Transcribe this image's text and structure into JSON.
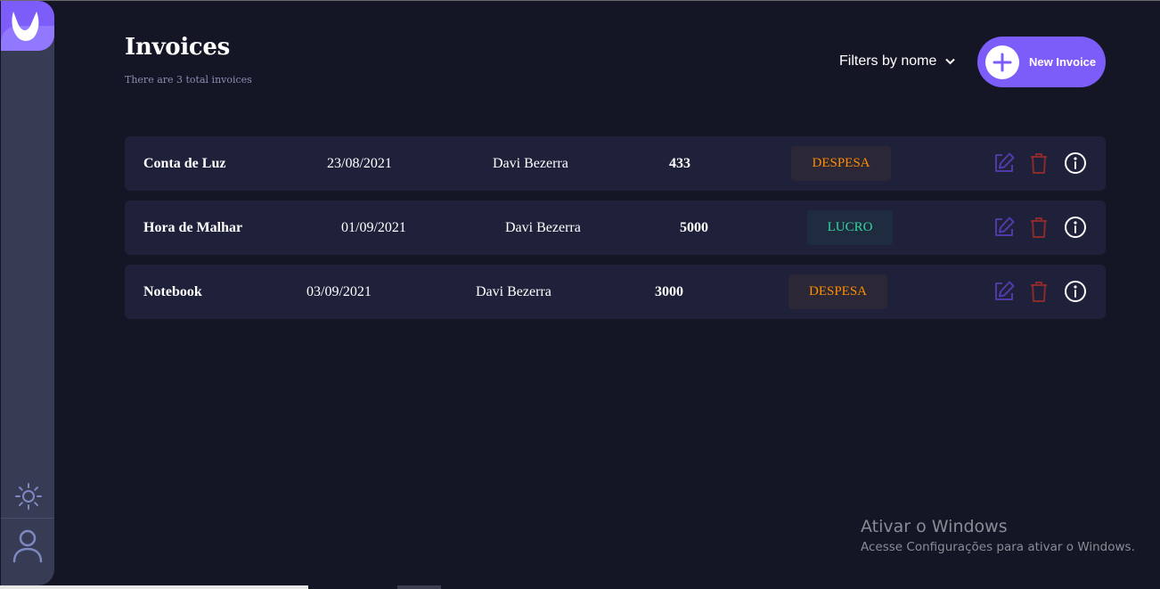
{
  "header": {
    "title": "Invoices",
    "subtitle": "There are 3 total invoices",
    "filter_label": "Filters by nome",
    "new_button_label": "New Invoice"
  },
  "invoices": [
    {
      "name": "Conta de Luz",
      "date": "23/08/2021",
      "client": "Davi Bezerra",
      "amount": "433",
      "status": "DESPESA"
    },
    {
      "name": "Hora de Malhar",
      "date": "01/09/2021",
      "client": "Davi Bezerra",
      "amount": "5000",
      "status": "LUCRO"
    },
    {
      "name": "Notebook",
      "date": "03/09/2021",
      "client": "Davi Bezerra",
      "amount": "3000",
      "status": "DESPESA"
    }
  ],
  "sidebar": {
    "icons": [
      "logo-icon",
      "sun-icon",
      "user-icon"
    ]
  },
  "watermark": {
    "title": "Ativar o Windows",
    "subtitle": "Acesse Configurações para ativar o Windows."
  },
  "colors": {
    "background": "#141625",
    "sidebar": "#373b53",
    "accent": "#7c5dfa",
    "row": "#1e2139",
    "despesa": "#ff8f00",
    "lucro": "#33d69f",
    "edit_icon": "#4f3aa8",
    "trash_icon": "#8a2a2a"
  }
}
